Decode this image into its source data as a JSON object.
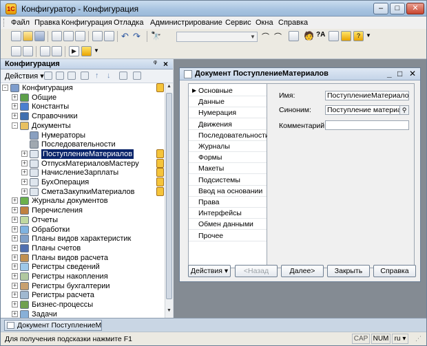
{
  "window": {
    "title": "Конфигуратор - Конфигурация"
  },
  "menu": [
    "Файл",
    "Правка",
    "Конфигурация",
    "Отладка",
    "Администрирование",
    "Сервис",
    "Окна",
    "Справка"
  ],
  "toolbar": {
    "combo_value": ""
  },
  "config_panel": {
    "title": "Конфигурация",
    "actions_label": "Действия",
    "tree": [
      {
        "label": "Конфигурация",
        "level": 0,
        "expander": "-",
        "icon": "config-icon",
        "ext": true
      },
      {
        "label": "Общие",
        "level": 1,
        "expander": "+",
        "icon": "common-icon"
      },
      {
        "label": "Константы",
        "level": 1,
        "expander": "+",
        "icon": "constants-icon"
      },
      {
        "label": "Справочники",
        "level": 1,
        "expander": "+",
        "icon": "catalogs-icon"
      },
      {
        "label": "Документы",
        "level": 1,
        "expander": "-",
        "icon": "documents-icon"
      },
      {
        "label": "Нумераторы",
        "level": 2,
        "expander": "",
        "icon": "numerator-icon"
      },
      {
        "label": "Последовательности",
        "level": 2,
        "expander": "",
        "icon": "sequence-icon"
      },
      {
        "label": "ПоступлениеМатериалов",
        "level": 2,
        "expander": "+",
        "icon": "document-icon",
        "selected": true,
        "ext": true
      },
      {
        "label": "ОтпускМатериаловМастеру",
        "level": 2,
        "expander": "+",
        "icon": "document-icon",
        "ext": true
      },
      {
        "label": "НачислениеЗарплаты",
        "level": 2,
        "expander": "+",
        "icon": "document-icon",
        "ext": true
      },
      {
        "label": "БухОперация",
        "level": 2,
        "expander": "+",
        "icon": "document-icon",
        "ext": true
      },
      {
        "label": "СметаЗакупкиМатериалов",
        "level": 2,
        "expander": "+",
        "icon": "document-icon",
        "ext": true
      },
      {
        "label": "Журналы документов",
        "level": 1,
        "expander": "+",
        "icon": "journals-icon"
      },
      {
        "label": "Перечисления",
        "level": 1,
        "expander": "+",
        "icon": "enums-icon"
      },
      {
        "label": "Отчеты",
        "level": 1,
        "expander": "+",
        "icon": "reports-icon"
      },
      {
        "label": "Обработки",
        "level": 1,
        "expander": "+",
        "icon": "processing-icon"
      },
      {
        "label": "Планы видов характеристик",
        "level": 1,
        "expander": "+",
        "icon": "chart-char-icon"
      },
      {
        "label": "Планы счетов",
        "level": 1,
        "expander": "+",
        "icon": "chart-accounts-icon"
      },
      {
        "label": "Планы видов расчета",
        "level": 1,
        "expander": "+",
        "icon": "chart-calc-icon"
      },
      {
        "label": "Регистры сведений",
        "level": 1,
        "expander": "+",
        "icon": "info-register-icon"
      },
      {
        "label": "Регистры накопления",
        "level": 1,
        "expander": "+",
        "icon": "accum-register-icon"
      },
      {
        "label": "Регистры бухгалтерии",
        "level": 1,
        "expander": "+",
        "icon": "acc-register-icon"
      },
      {
        "label": "Регистры расчета",
        "level": 1,
        "expander": "+",
        "icon": "calc-register-icon"
      },
      {
        "label": "Бизнес-процессы",
        "level": 1,
        "expander": "+",
        "icon": "business-process-icon"
      },
      {
        "label": "Задачи",
        "level": 1,
        "expander": "+",
        "icon": "tasks-icon"
      }
    ]
  },
  "dialog": {
    "title": "Документ ПоступлениеМатериалов",
    "nav": [
      "Основные",
      "Данные",
      "Нумерация",
      "Движения",
      "Последовательности",
      "Журналы",
      "Формы",
      "Макеты",
      "Подсистемы",
      "Ввод на основании",
      "Права",
      "Интерфейсы",
      "Обмен данными",
      "Прочее"
    ],
    "active_nav": "Основные",
    "fields": {
      "name_label": "Имя:",
      "name_value": "ПоступлениеМатериалов",
      "synonym_label": "Синоним:",
      "synonym_value": "Поступление материалов",
      "comment_label": "Комментарий:",
      "comment_value": ""
    },
    "buttons": {
      "actions": "Действия",
      "back": "<Назад",
      "next": "Далее>",
      "close": "Закрыть",
      "help": "Справка"
    }
  },
  "taskbar": {
    "tab_label": "Документ ПоступлениеМат..."
  },
  "status": {
    "hint": "Для получения подсказки нажмите F1",
    "cap": "CAP",
    "num": "NUM",
    "lang": "ru"
  }
}
